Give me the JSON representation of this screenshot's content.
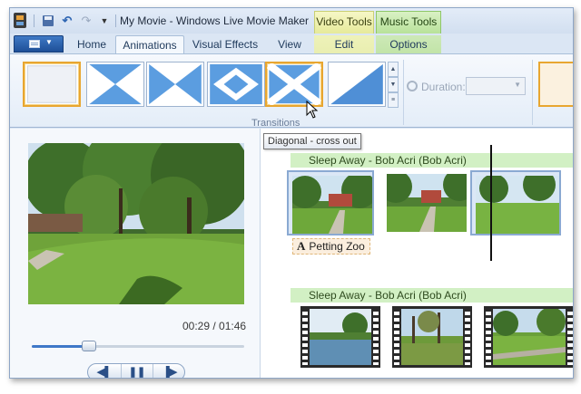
{
  "window": {
    "title": "My Movie - Windows Live Movie Maker"
  },
  "quick_access": {
    "icons": [
      "save-icon",
      "undo-icon",
      "redo-icon",
      "customize-dropdown-icon"
    ]
  },
  "contextual_tabs": {
    "video_tools": "Video Tools",
    "music_tools": "Music Tools"
  },
  "tabs": {
    "home": "Home",
    "animations": "Animations",
    "visual_effects": "Visual Effects",
    "view": "View",
    "edit": "Edit",
    "options": "Options"
  },
  "ribbon": {
    "group_label": "Transitions",
    "duration_label": "Duration:",
    "duration_value": ""
  },
  "tooltip": "Diagonal - cross out",
  "preview": {
    "timecode": "00:29 / 01:46",
    "progress": 0.27
  },
  "storyboard": {
    "track1_title": "Sleep Away - Bob Acri (Bob Acri)",
    "track2_title": "Sleep Away - Bob Acri (Bob Acri)",
    "caption": "Petting Zoo",
    "caption_glyph": "A"
  },
  "colors": {
    "selection_accent": "#e8a630",
    "music_bar": "#d2f0c4",
    "video_tools_tab": "#f6f7c6",
    "music_tools_tab": "#d9f1c4"
  }
}
